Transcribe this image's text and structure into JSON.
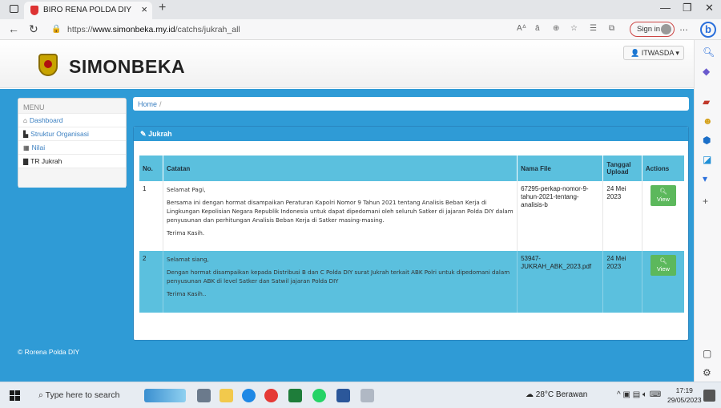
{
  "browser": {
    "tab_title": "BIRO RENA POLDA DIY",
    "tab_close": "×",
    "new_tab": "+",
    "url_prefix": "https://",
    "url_domain": "www.simonbeka.my.id",
    "url_path": "/catchs/jukrah_all",
    "sign_in": "Sign in",
    "more": "…",
    "bing": "b"
  },
  "header": {
    "brand": "SIMONBEKA",
    "user_menu": "ITWASDA"
  },
  "sidebar": {
    "heading": "MENU",
    "items": [
      {
        "label": "Dashboard",
        "icon": "home-icon"
      },
      {
        "label": "Struktur Organisasi",
        "icon": "file-icon"
      },
      {
        "label": "Nilai",
        "icon": "table-icon"
      },
      {
        "label": "TR Jukrah",
        "icon": "doc-icon"
      }
    ]
  },
  "breadcrumb": {
    "home": "Home",
    "separator": "/"
  },
  "panel": {
    "title": "Jukrah",
    "columns": [
      "No.",
      "Catatan",
      "Nama File",
      "Tanggal Upload",
      "Actions"
    ],
    "rows": [
      {
        "no": "1",
        "greeting": "Selamat Pagi,",
        "body": "Bersama ini dengan hormat disampaikan Peraturan Kapolri Nomor 9 Tahun 2021 tentang Analisis Beban Kerja di Lingkungan Kepolisian Negara Republik Indonesia untuk dapat dipedomani oleh seluruh Satker di jajaran Polda DIY dalam penyusunan dan perhitungan Analisis Beban Kerja di Satker masing-masing.",
        "closing": "Terima Kasih.",
        "file": "67295-perkap-nomor-9-tahun-2021-tentang-analisis-b",
        "date": "24 Mei 2023",
        "action": "View"
      },
      {
        "no": "2",
        "greeting": "Selamat siang,",
        "body": "Dengan hormat disampaikan kepada Distribusi B dan C Polda DIY surat Jukrah terkait ABK Polri untuk dipedomani dalam penyusunan ABK di level Satker dan Satwil jajaran Polda DIY",
        "closing": "Terima Kasih..",
        "file": "53947-JUKRAH_ABK_2023.pdf",
        "date": "24 Mei 2023",
        "action": "View"
      }
    ]
  },
  "footer": {
    "text": "© Rorena Polda DIY"
  },
  "taskbar": {
    "search_placeholder": "Type here to search",
    "weather": "28°C  Berawan",
    "time": "17:19",
    "date": "29/05/2023"
  },
  "colors": {
    "brand_blue": "#2f9bd6",
    "table_header": "#5bc0de",
    "view_button": "#5cb85c"
  }
}
